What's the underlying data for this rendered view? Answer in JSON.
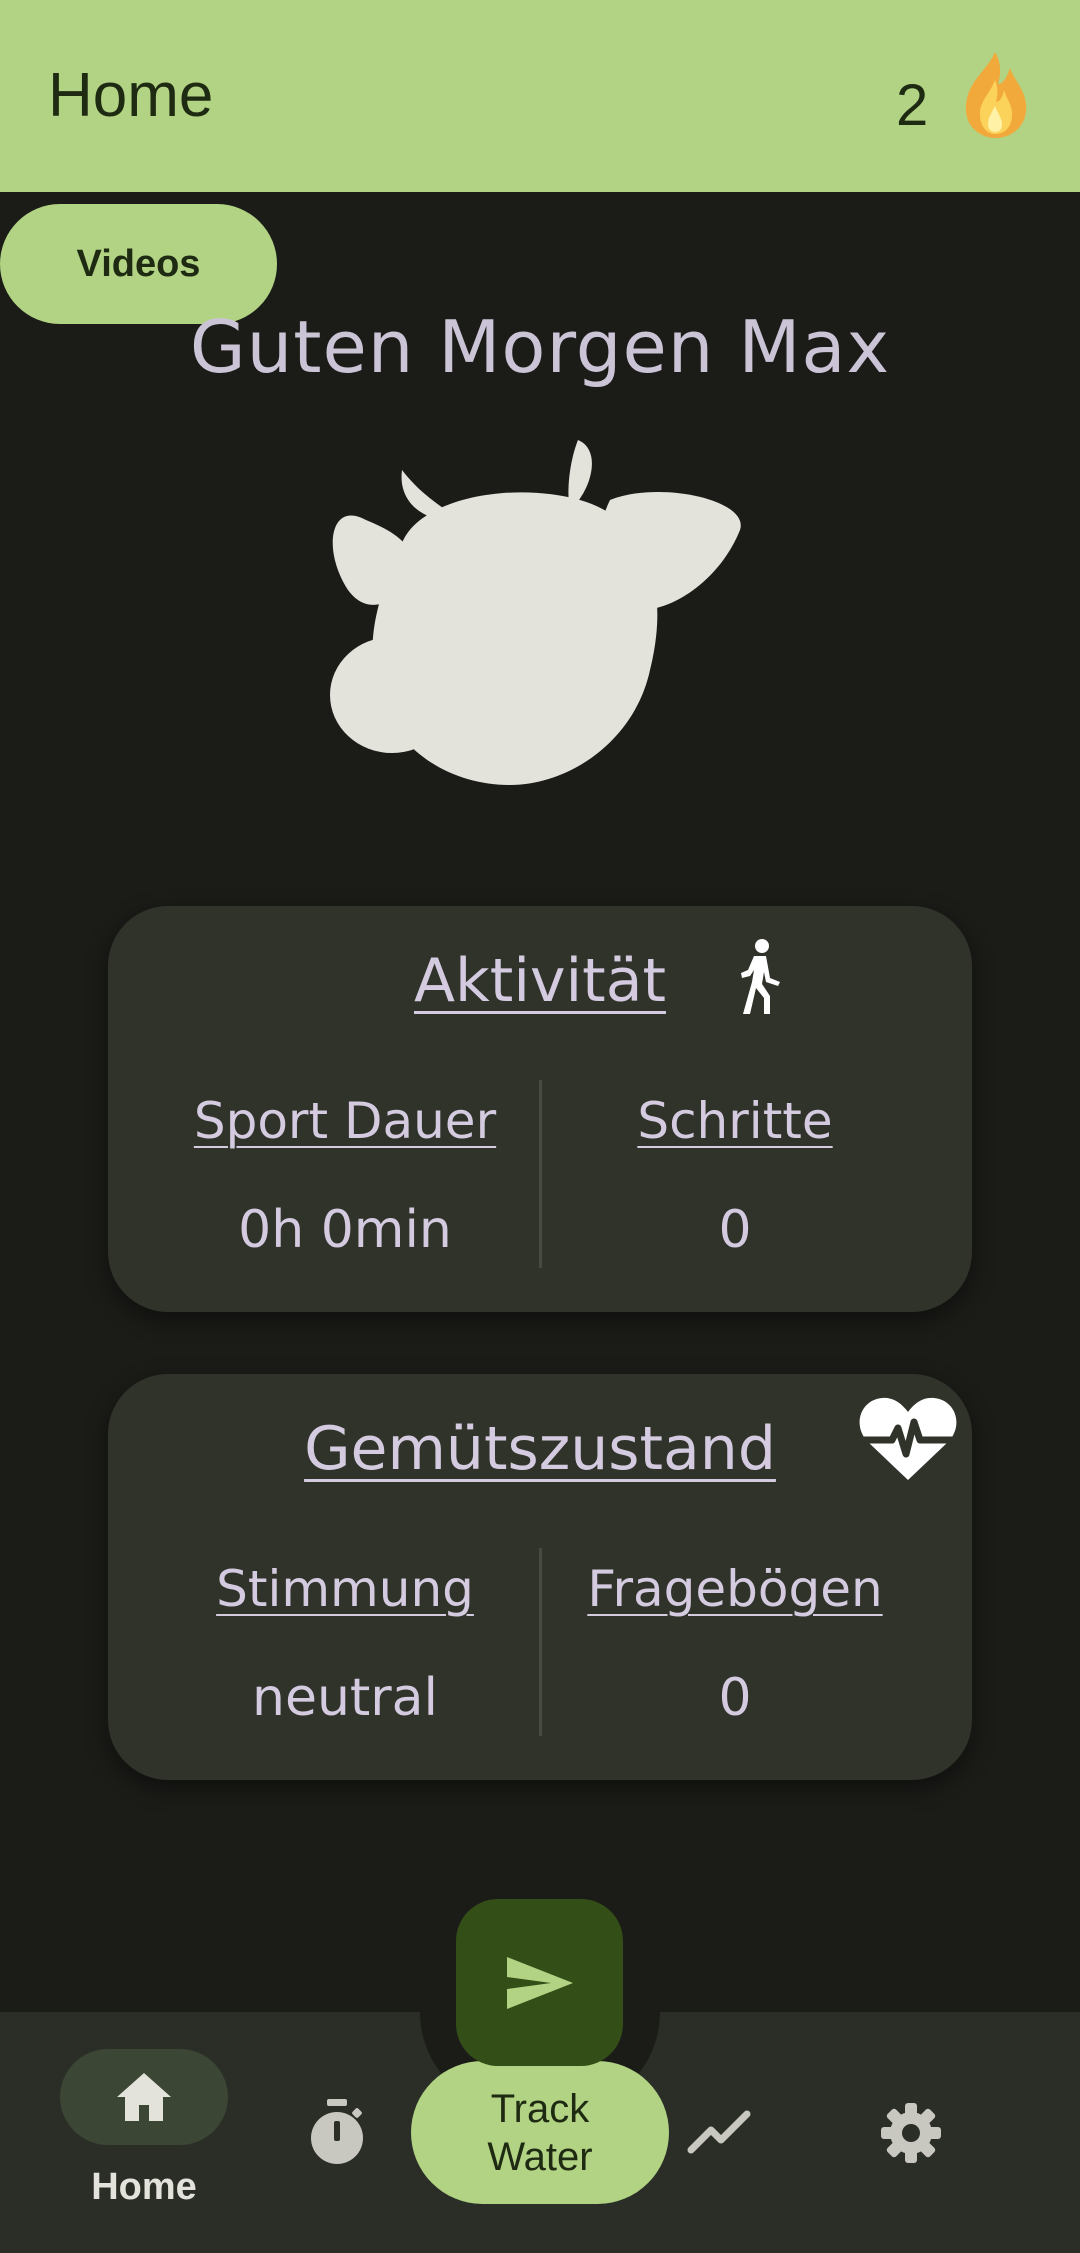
{
  "header": {
    "title": "Home",
    "streak_count": "2",
    "streak_icon": "flame-icon"
  },
  "videos_button": {
    "label": "Videos"
  },
  "greeting": "Guten Morgen Max",
  "mascot_icon": "cow-icon",
  "activity_card": {
    "title": "Aktivität",
    "icon": "walking-person-icon",
    "left_label": "Sport Dauer",
    "left_value": "0h 0min",
    "right_label": "Schritte",
    "right_value": "0"
  },
  "mood_card": {
    "title": "Gemütszustand",
    "icon": "heartbeat-icon",
    "left_label": "Stimmung",
    "left_value": "neutral",
    "right_label": "Fragebögen",
    "right_value": "0"
  },
  "fab": {
    "icon": "send-icon"
  },
  "bottom_nav": {
    "home_label": "Home",
    "track_water_line1": "Track",
    "track_water_line2": "Water",
    "items": [
      "home-icon",
      "stopwatch-icon",
      "trending-icon",
      "gear-icon"
    ]
  },
  "colors": {
    "accent": "#b1d383",
    "background": "#1b1c18",
    "card": "#30332a",
    "fab": "#344e17",
    "text": "#d4cbe0"
  }
}
